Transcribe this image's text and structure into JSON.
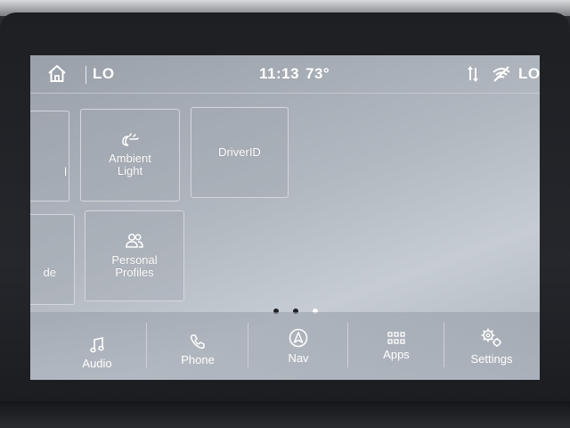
{
  "status": {
    "left_label": "LO",
    "time": "11:13",
    "temperature": "73°",
    "right_label": "LO"
  },
  "tiles": {
    "partial_top": "l",
    "partial_bottom": "de",
    "ambient_light": "Ambient\nLight",
    "driver_id": "DriverID",
    "personal_profiles": "Personal\nProfiles"
  },
  "pager": {
    "pages": 3,
    "active_index": 2
  },
  "nav": {
    "audio": "Audio",
    "phone": "Phone",
    "nav": "Nav",
    "apps": "Apps",
    "settings": "Settings"
  },
  "icons": {
    "home": "home-icon",
    "data_transfer": "data-transfer-icon",
    "wifi_off": "wifi-off-icon",
    "ambient": "ambient-light-icon",
    "profiles": "profiles-icon",
    "audio": "music-note-icon",
    "phone": "phone-icon",
    "nav": "navigation-icon",
    "apps": "apps-grid-icon",
    "settings": "gear-icon"
  },
  "colors": {
    "screen_bg": "#b2b8c0",
    "text": "#ffffff",
    "dot_inactive": "#1e2024",
    "dot_active": "#ffffff"
  }
}
